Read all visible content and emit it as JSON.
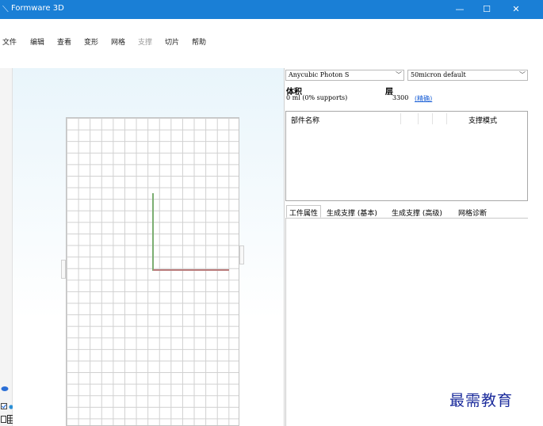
{
  "window": {
    "title": "Formware 3D",
    "minimize_glyph": "—",
    "maximize_glyph": "☐",
    "close_glyph": "✕"
  },
  "menu": {
    "items": [
      {
        "label": "文件",
        "enabled": true
      },
      {
        "label": "编辑",
        "enabled": true
      },
      {
        "label": "查看",
        "enabled": true
      },
      {
        "label": "变形",
        "enabled": true
      },
      {
        "label": "网格",
        "enabled": true
      },
      {
        "label": "支撑",
        "enabled": false
      },
      {
        "label": "切片",
        "enabled": true
      },
      {
        "label": "帮助",
        "enabled": true
      }
    ]
  },
  "toolbar": {
    "icons": [
      "new-icon",
      "open-icon",
      "save-icon",
      "settings-icon",
      "undo-icon",
      "redo-icon",
      "model-icon",
      "sphere-icon",
      "view-front-icon",
      "view-back-icon",
      "view-left-icon",
      "view-right-icon",
      "view-top-icon",
      "view-bottom-icon",
      "support-icon",
      "support-tree-icon",
      "support-edit-icon",
      "align-icon",
      "align-x-icon",
      "align-y-icon",
      "move-icon",
      "add-icon",
      "rotate-icon",
      "scale-icon",
      "slice-icon",
      "grid-icon",
      "cut-icon",
      "measure-icon",
      "layers-icon",
      "frame-icon",
      "hollow-icon",
      "disk-icon",
      "ring-icon",
      "dot-icon",
      "disc-icon",
      "circle-icon"
    ],
    "colors": {
      "blue": "#2b6fd6",
      "teal": "#1d9c8a",
      "dark": "#2a2a2a",
      "green": "#3a9a3a",
      "gray": "#9a9a9a"
    }
  },
  "printer": {
    "selected": "Anycubic Photon S",
    "profile": "50micron default"
  },
  "stats": {
    "volume_label": "体积",
    "volume_value": "0 ml (0% supports)",
    "layers_label": "层",
    "layers_value": "3300",
    "layers_link": "(精确)"
  },
  "parts_table": {
    "columns": [
      "部件名称",
      "",
      "",
      "",
      "支撑模式"
    ]
  },
  "tabs": [
    {
      "label": "工件属性",
      "active": true
    },
    {
      "label": "生成支撑 (基本)",
      "active": false
    },
    {
      "label": "生成支撑 (高级)",
      "active": false
    },
    {
      "label": "网格诊断",
      "active": false
    }
  ],
  "watermark": "最需教育",
  "colors": {
    "titlebar": "#1a7fd6",
    "axis_y": "#7cae72",
    "axis_x": "#b87a7a",
    "link": "#1a5fd6",
    "watermark": "#1c2c9c"
  }
}
